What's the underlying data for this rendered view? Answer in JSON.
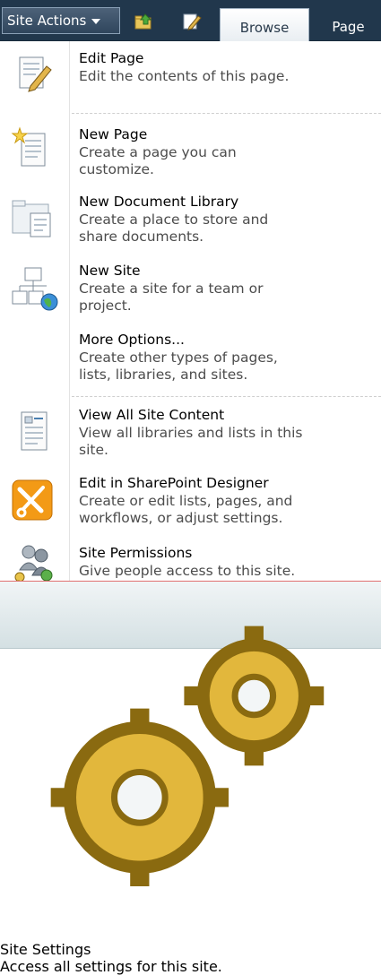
{
  "toolbar": {
    "site_actions_label": "Site Actions",
    "tabs": [
      {
        "label": "Browse",
        "selected": true
      },
      {
        "label": "Page",
        "selected": false
      }
    ],
    "icons": [
      "navigate-up-icon",
      "edit-icon"
    ]
  },
  "menu": {
    "items": [
      {
        "title": "Edit Page",
        "desc": "Edit the contents of this page.",
        "icon": "edit-page-icon"
      },
      {
        "title": "New Page",
        "desc": "Create a page you can customize.",
        "icon": "new-page-icon"
      },
      {
        "title": "New Document Library",
        "desc": "Create a place to store and share documents.",
        "icon": "document-library-icon"
      },
      {
        "title": "New Site",
        "desc": "Create a site for a team or project.",
        "icon": "new-site-icon"
      },
      {
        "title": "More Options...",
        "desc": "Create other types of pages, lists, libraries, and sites.",
        "icon": ""
      },
      {
        "title": "View All Site Content",
        "desc": "View all libraries and lists in this site.",
        "icon": "site-content-icon"
      },
      {
        "title": "Edit in SharePoint Designer",
        "desc": "Create or edit lists, pages, and workflows, or adjust settings.",
        "icon": "sharepoint-designer-icon"
      },
      {
        "title": "Site Permissions",
        "desc": "Give people access to this site.",
        "icon": "permissions-icon"
      },
      {
        "title": "Site Settings",
        "desc": "Access all settings for this site.",
        "icon": "settings-gears-icon",
        "highlighted": true
      }
    ]
  },
  "colors": {
    "ribbon": "#21374c",
    "highlight_border": "#e07070",
    "designer_orange": "#f39a16"
  }
}
